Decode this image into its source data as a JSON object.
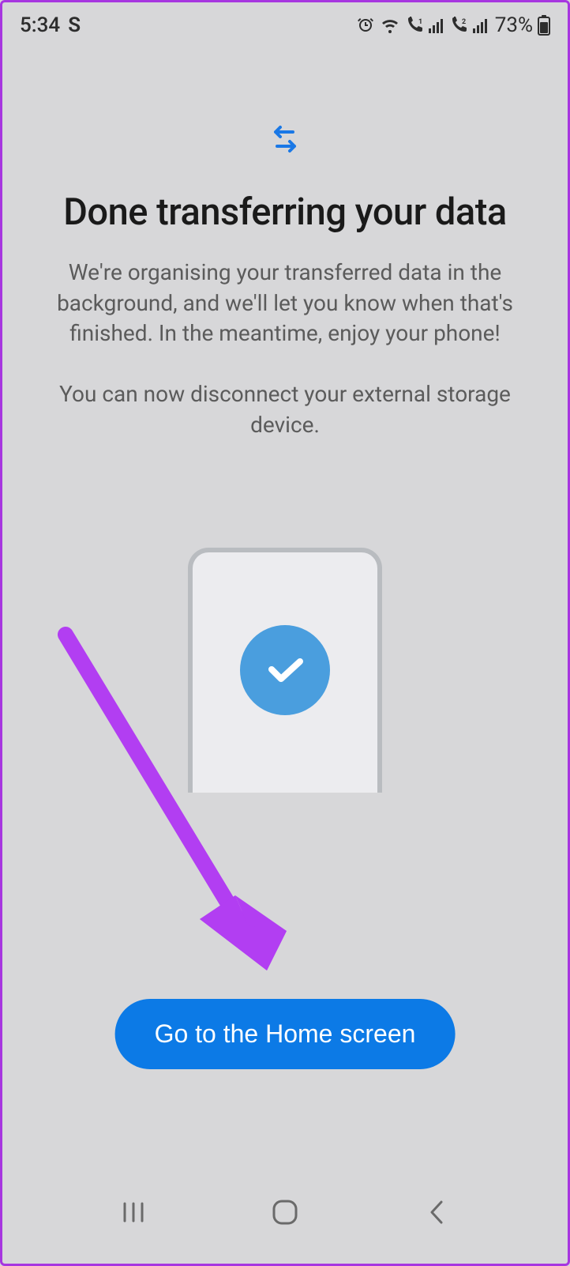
{
  "status": {
    "time": "5:34",
    "left_glyph": "S",
    "battery": "73%"
  },
  "main": {
    "title": "Done transferring your data",
    "description1": "We're organising your transferred data in the background, and we'll let you know when that's finished. In the meantime, enjoy your phone!",
    "description2": "You can now disconnect your external storage device."
  },
  "button": {
    "home_label": "Go to the Home screen"
  }
}
